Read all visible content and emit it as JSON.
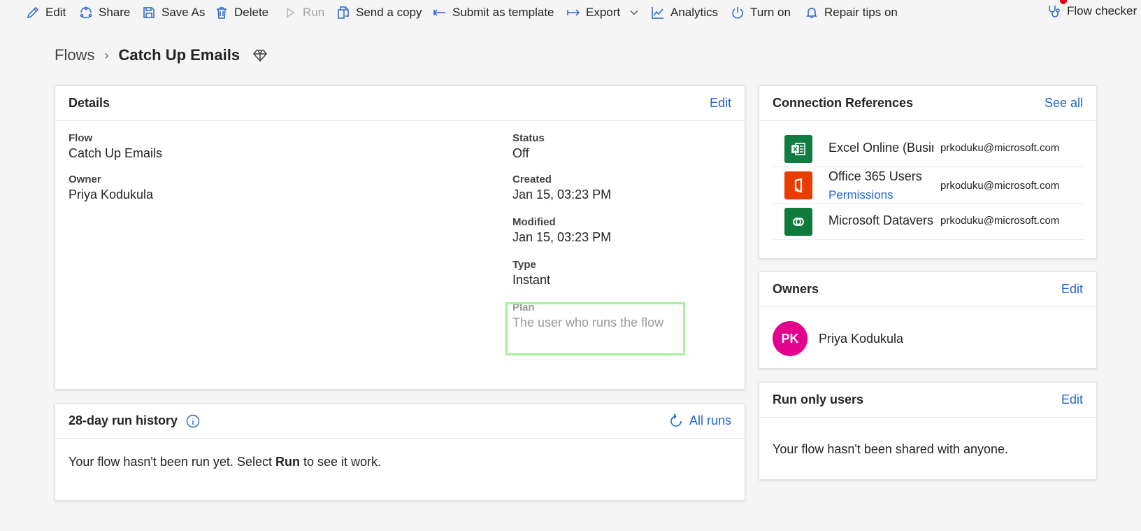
{
  "toolbar": {
    "items": [
      {
        "label": "Edit",
        "icon": "pencil-icon"
      },
      {
        "label": "Share",
        "icon": "share-icon"
      },
      {
        "label": "Save As",
        "icon": "save-icon"
      },
      {
        "label": "Delete",
        "icon": "trash-icon"
      },
      {
        "label": "Run",
        "icon": "play-icon",
        "disabled": true
      },
      {
        "label": "Send a copy",
        "icon": "copy-icon"
      },
      {
        "label": "Submit as template",
        "icon": "arrow-left-icon"
      },
      {
        "label": "Export",
        "icon": "arrow-right-icon"
      },
      {
        "label": "Analytics",
        "icon": "chart-icon"
      },
      {
        "label": "Turn on",
        "icon": "power-icon"
      },
      {
        "label": "Repair tips on",
        "icon": "bell-icon"
      }
    ],
    "flow_checker": "Flow checker"
  },
  "breadcrumb": {
    "root": "Flows",
    "current": "Catch Up Emails"
  },
  "details": {
    "title": "Details",
    "edit": "Edit",
    "flow_label": "Flow",
    "flow_value": "Catch Up Emails",
    "owner_label": "Owner",
    "owner_value": "Priya Kodukula",
    "status_label": "Status",
    "status_value": "Off",
    "created_label": "Created",
    "created_value": "Jan 15, 03:23 PM",
    "modified_label": "Modified",
    "modified_value": "Jan 15, 03:23 PM",
    "type_label": "Type",
    "type_value": "Instant",
    "plan_label": "Plan",
    "plan_value": "The user who runs the flow"
  },
  "run_history": {
    "title": "28-day run history",
    "all_runs": "All runs",
    "msg_before": "Your flow hasn't been run yet. Select ",
    "msg_bold": "Run",
    "msg_after": " to see it work."
  },
  "connections": {
    "title": "Connection References",
    "see_all": "See all",
    "items": [
      {
        "name": "Excel Online (Business)",
        "email": "prkoduku@microsoft.com",
        "color": "#107c41"
      },
      {
        "name": "Office 365 Users",
        "perm": "Permissions",
        "email": "prkoduku@microsoft.com",
        "color": "#eb3c00"
      },
      {
        "name": "Microsoft Dataverse",
        "email": "prkoduku@microsoft.com",
        "color": "#0e7a3b"
      }
    ]
  },
  "owners": {
    "title": "Owners",
    "edit": "Edit",
    "initials": "PK",
    "name": "Priya Kodukula"
  },
  "run_only": {
    "title": "Run only users",
    "edit": "Edit",
    "msg": "Your flow hasn't been shared with anyone."
  }
}
